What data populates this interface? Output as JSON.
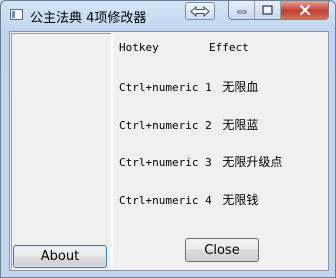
{
  "window": {
    "title": "公主法典 4项修改器"
  },
  "table": {
    "header": {
      "hotkey": "Hotkey",
      "effect": "Effect"
    },
    "rows": [
      {
        "hotkey": "Ctrl+numeric 1",
        "effect": "无限血"
      },
      {
        "hotkey": "Ctrl+numeric 2",
        "effect": "无限蓝"
      },
      {
        "hotkey": "Ctrl+numeric 3",
        "effect": "无限升级点"
      },
      {
        "hotkey": "Ctrl+numeric 4",
        "effect": "无限钱"
      }
    ]
  },
  "buttons": {
    "about": "About",
    "close": "Close"
  }
}
